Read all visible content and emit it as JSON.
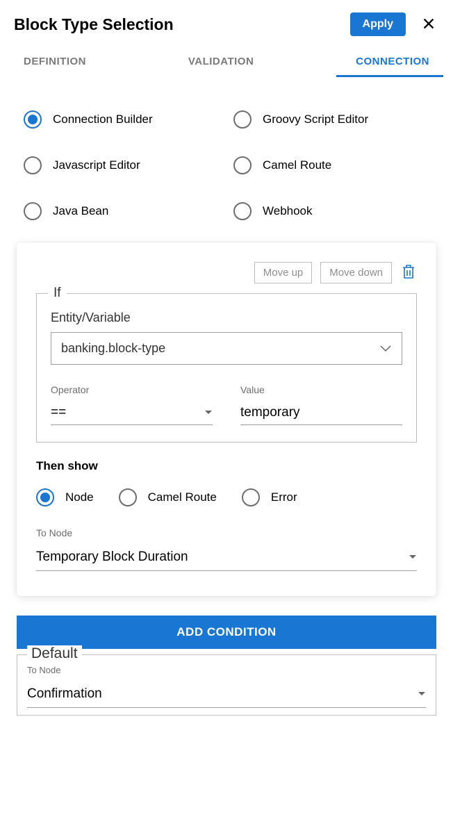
{
  "header": {
    "title": "Block Type Selection",
    "apply_label": "Apply"
  },
  "tabs": {
    "definition": "DEFINITION",
    "validation": "VALIDATION",
    "connection": "CONNECTION"
  },
  "connection_types": {
    "connection_builder": "Connection Builder",
    "groovy_script": "Groovy Script Editor",
    "javascript_editor": "Javascript Editor",
    "camel_route": "Camel Route",
    "java_bean": "Java Bean",
    "webhook": "Webhook"
  },
  "card": {
    "move_up": "Move up",
    "move_down": "Move down",
    "if_label": "If",
    "entity_label": "Entity/Variable",
    "entity_value": "banking.block-type",
    "operator_label": "Operator",
    "operator_value": "==",
    "value_label": "Value",
    "value_value": "temporary",
    "then_label": "Then show",
    "then_node": "Node",
    "then_camel": "Camel Route",
    "then_error": "Error",
    "to_node_label": "To Node",
    "to_node_value": "Temporary Block Duration"
  },
  "add_condition_label": "ADD CONDITION",
  "default": {
    "legend": "Default",
    "to_node_label": "To Node",
    "to_node_value": "Confirmation"
  }
}
